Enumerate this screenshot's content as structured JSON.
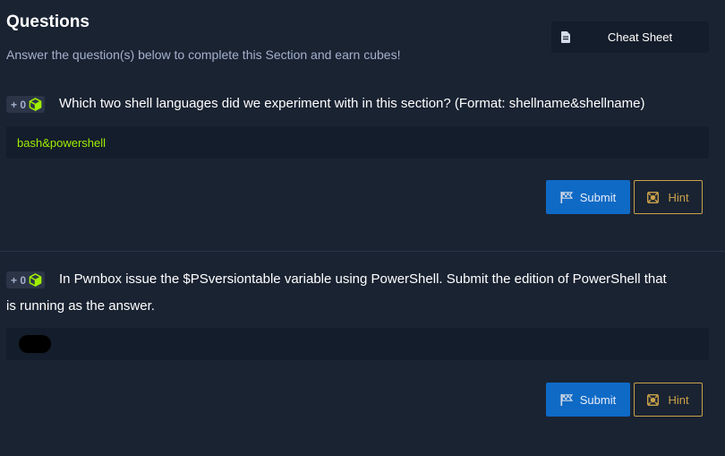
{
  "header": {
    "title": "Questions",
    "subtitle": "Answer the question(s) below to complete this Section and earn cubes!",
    "cheat_sheet_label": "Cheat Sheet"
  },
  "questions": [
    {
      "reward": "+ 0",
      "text": "Which two shell languages did we experiment with in this section? (Format: shellname&shellname)",
      "answer": "bash&powershell",
      "submit_label": "Submit",
      "hint_label": "Hint"
    },
    {
      "reward": "+ 0",
      "text_line1": "In Pwnbox issue the $PSversiontable variable using PowerShell. Submit the edition of PowerShell that",
      "text_line2": "is running as the answer.",
      "answer": "",
      "submit_label": "Submit",
      "hint_label": "Hint"
    }
  ],
  "colors": {
    "background": "#1a2332",
    "answer_green": "#9fef00",
    "submit_blue": "#0f6ac5",
    "hint_gold": "#caa14a",
    "cube_green": "#9fef00"
  },
  "icons": {
    "cheat_sheet": "document-icon",
    "badge": "cube-icon",
    "submit": "flag-icon",
    "hint": "hint-icon"
  }
}
